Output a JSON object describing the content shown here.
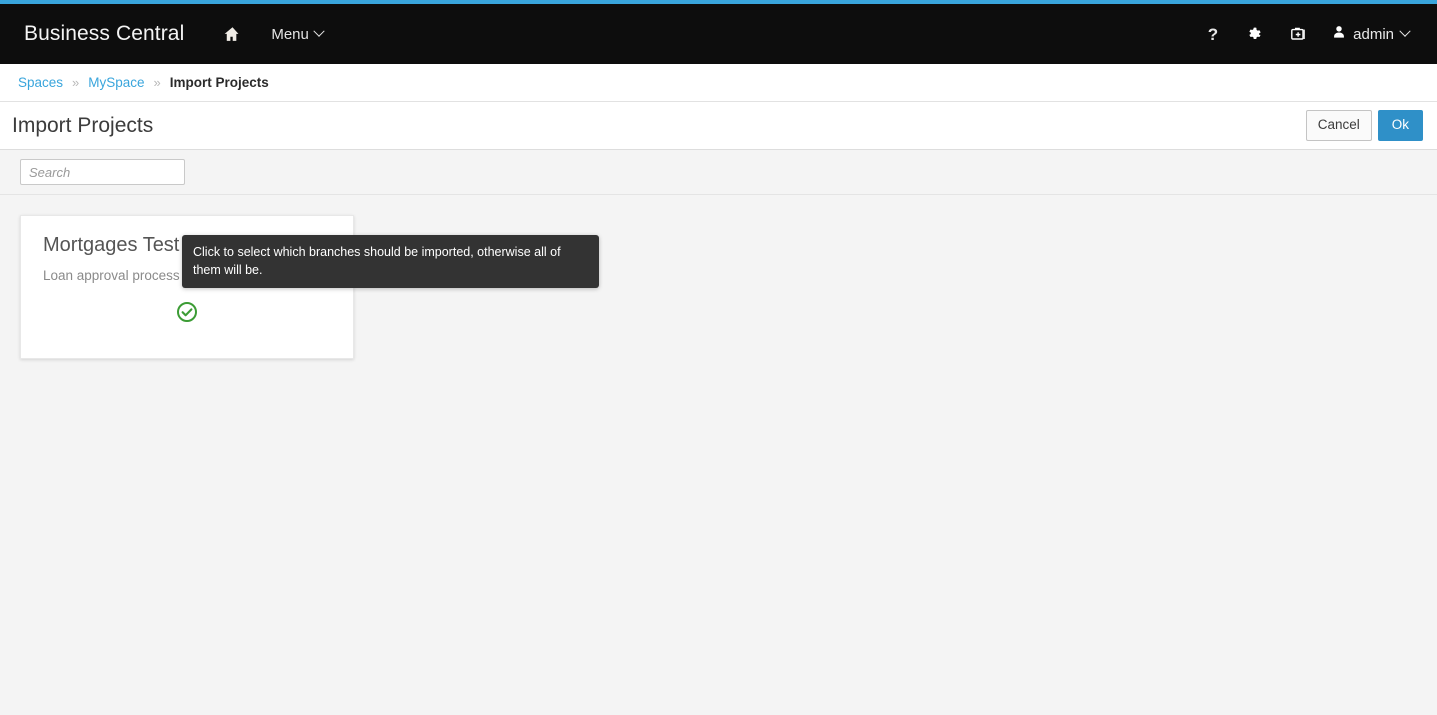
{
  "accent_color": "#39a5dc",
  "navbar": {
    "brand": "Business Central",
    "home_icon": "home-icon",
    "menu_label": "Menu",
    "help_icon": "question-mark-icon",
    "settings_icon": "gear-icon",
    "toolbox_icon": "briefcase-kit-icon",
    "user_icon": "user-icon",
    "user_name": "admin"
  },
  "breadcrumb": {
    "items": [
      {
        "label": "Spaces",
        "active": false
      },
      {
        "label": "MySpace",
        "active": false
      },
      {
        "label": "Import Projects",
        "active": true
      }
    ],
    "separator": "»"
  },
  "title_bar": {
    "title": "Import Projects",
    "cancel_label": "Cancel",
    "ok_label": "Ok"
  },
  "search": {
    "placeholder": "Search",
    "value": ""
  },
  "cards": [
    {
      "title": "Mortgages Test",
      "branch_icon": "code-branch-icon",
      "description": "Loan approval process automation",
      "status_icon": "circle-check-icon",
      "status_color": "#3c9c35",
      "selected": true
    }
  ],
  "tooltip": {
    "text": "Click to select which branches should be imported, otherwise all of them will be."
  }
}
